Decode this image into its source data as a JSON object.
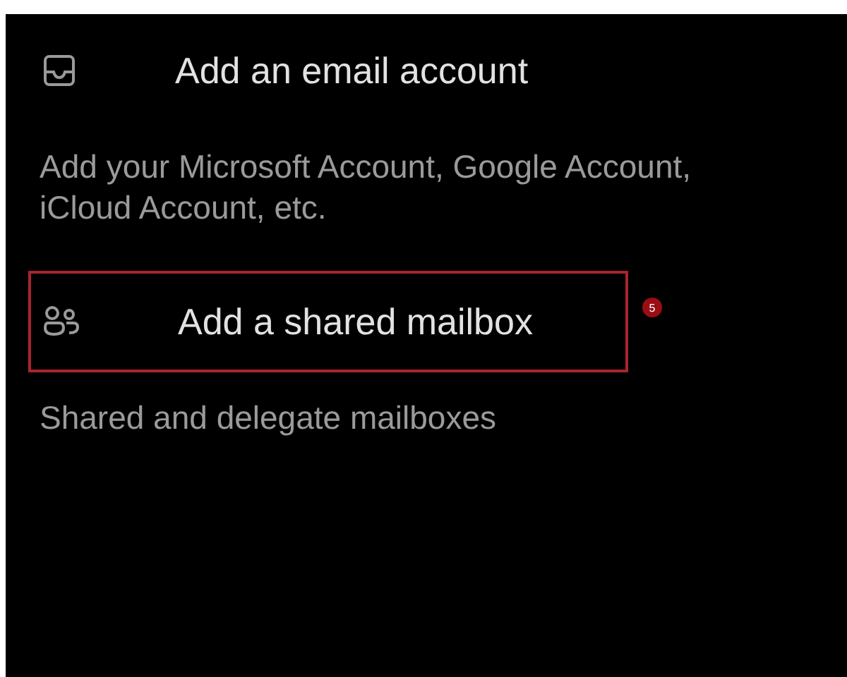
{
  "options": [
    {
      "kind": "email",
      "title": "Add an email account",
      "description": "Add your Microsoft Account, Google Account, iCloud Account, etc.",
      "highlighted": false
    },
    {
      "kind": "shared",
      "title": "Add a shared mailbox",
      "description": "Shared and delegate mailboxes",
      "highlighted": true,
      "badge": "5"
    }
  ]
}
